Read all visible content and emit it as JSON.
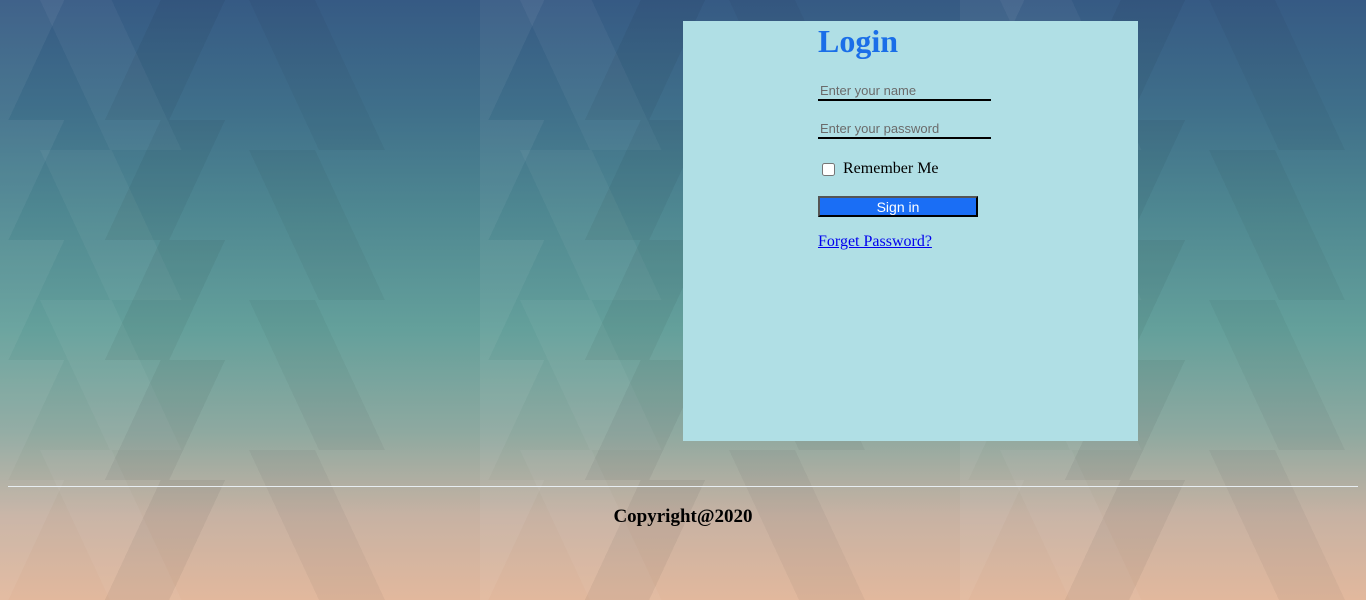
{
  "login": {
    "title": "Login",
    "name_placeholder": "Enter your name",
    "password_placeholder": "Enter your password",
    "remember_label": "Remember Me",
    "remember_checked": false,
    "signin_label": "Sign in",
    "forgot_label": "Forget Password?"
  },
  "footer": {
    "copyright": "Copyright@2020"
  },
  "colors": {
    "panel_bg": "#b0dfe5",
    "title": "#1a6ee8",
    "button": "#1a6ef5",
    "link": "#0000ee"
  }
}
